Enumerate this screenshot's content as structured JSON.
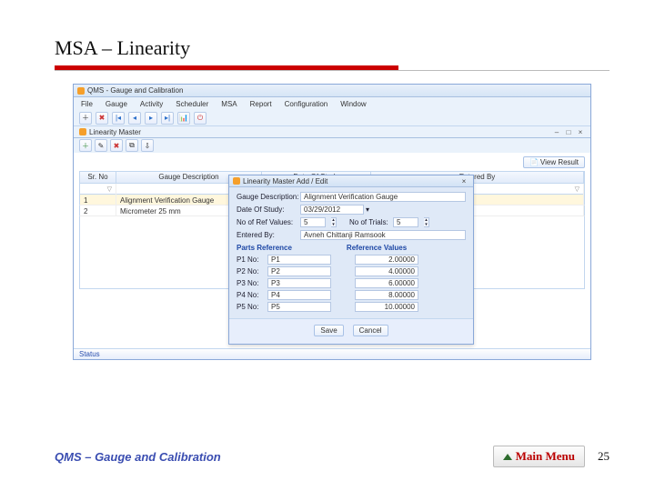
{
  "slide": {
    "title": "MSA – Linearity",
    "footer_title": "QMS – Gauge and Calibration",
    "main_menu_label": "Main Menu",
    "page_number": "25"
  },
  "app": {
    "window_title": "QMS - Gauge and Calibration",
    "menu": {
      "file": "File",
      "gauge": "Gauge",
      "activity": "Activity",
      "scheduler": "Scheduler",
      "msa": "MSA",
      "report": "Report",
      "configuration": "Configuration",
      "window": "Window"
    },
    "subwindow_title": "Linearity Master",
    "view_result_label": "View Result",
    "grid_headers": {
      "sr_no": "Sr. No",
      "gauge_desc": "Gauge Description",
      "date_of_study": "Date Of Study",
      "entered_by": "Entered By"
    },
    "filter_glyph": "▽",
    "rows": [
      {
        "no": "1",
        "desc": "Alignment Verification Gauge"
      },
      {
        "no": "2",
        "desc": "Micrometer 25 mm"
      }
    ],
    "status_label": "Status"
  },
  "dialog": {
    "title": "Linearity Master Add / Edit",
    "labels": {
      "gauge_desc": "Gauge Description:",
      "date_of_study": "Date Of Study:",
      "no_of_ref_values": "No of Ref Values:",
      "no_of_trials": "No of Trials:",
      "entered_by": "Entered By:",
      "parts_section": "Parts Reference",
      "ref_values_col": "Reference Values",
      "p1": "P1 No:",
      "p2": "P2 No:",
      "p3": "P3 No:",
      "p4": "P4 No:",
      "p5": "P5 No:"
    },
    "values": {
      "gauge_desc": "Alignment Verification Gauge",
      "date_of_study": "03/29/2012",
      "no_of_ref_values": "5",
      "no_of_trials_label": "No of Trials:",
      "no_of_trials": "5",
      "entered_by": "Avneh Chittanji Ramsook",
      "p1_name": "P1",
      "p2_name": "P2",
      "p3_name": "P3",
      "p4_name": "P4",
      "p5_name": "P5",
      "p1_val": "2.00000",
      "p2_val": "4.00000",
      "p3_val": "6.00000",
      "p4_val": "8.00000",
      "p5_val": "10.00000"
    },
    "buttons": {
      "save": "Save",
      "cancel": "Cancel"
    }
  }
}
